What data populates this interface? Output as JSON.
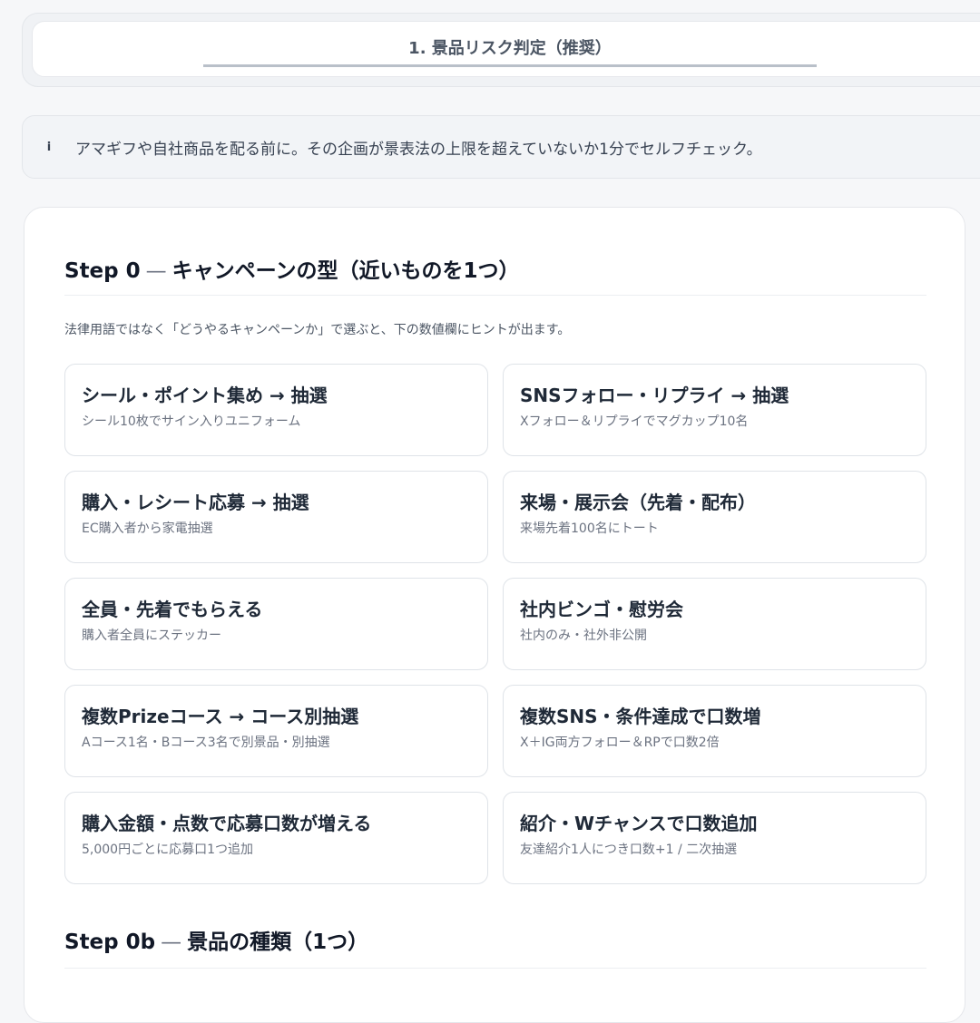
{
  "tabs": [
    {
      "label": "1. 景品リスク判定（推奨）"
    }
  ],
  "info": {
    "icon": "i",
    "text": "アマギフや自社商品を配る前に。その企画が景表法の上限を超えていないか1分でセルフチェック。"
  },
  "step0": {
    "label": "Step 0",
    "dash": "—",
    "title": "キャンペーンの型（近いものを1つ）",
    "hint": "法律用語ではなく「どうやるキャンペーンか」で選ぶと、下の数値欄にヒントが出ます。",
    "options": [
      {
        "title": "シール・ポイント集め → 抽選",
        "sub": "シール10枚でサイン入りユニフォーム"
      },
      {
        "title": "SNSフォロー・リプライ → 抽選",
        "sub": "Xフォロー＆リプライでマグカップ10名"
      },
      {
        "title": "購入・レシート応募 → 抽選",
        "sub": "EC購入者から家電抽選"
      },
      {
        "title": "来場・展示会（先着・配布）",
        "sub": "来場先着100名にトート"
      },
      {
        "title": "全員・先着でもらえる",
        "sub": "購入者全員にステッカー"
      },
      {
        "title": "社内ビンゴ・慰労会",
        "sub": "社内のみ・社外非公開"
      },
      {
        "title": "複数Prizeコース → コース別抽選",
        "sub": "Aコース1名・Bコース3名で別景品・別抽選"
      },
      {
        "title": "複数SNS・条件達成で口数増",
        "sub": "X＋IG両方フォロー＆RPで口数2倍"
      },
      {
        "title": "購入金額・点数で応募口数が増える",
        "sub": "5,000円ごとに応募口1つ追加"
      },
      {
        "title": "紹介・Wチャンスで口数追加",
        "sub": "友達紹介1人につき口数+1 / 二次抽選"
      }
    ]
  },
  "step0b": {
    "label": "Step 0b",
    "dash": "—",
    "title": "景品の種類（1つ）"
  }
}
